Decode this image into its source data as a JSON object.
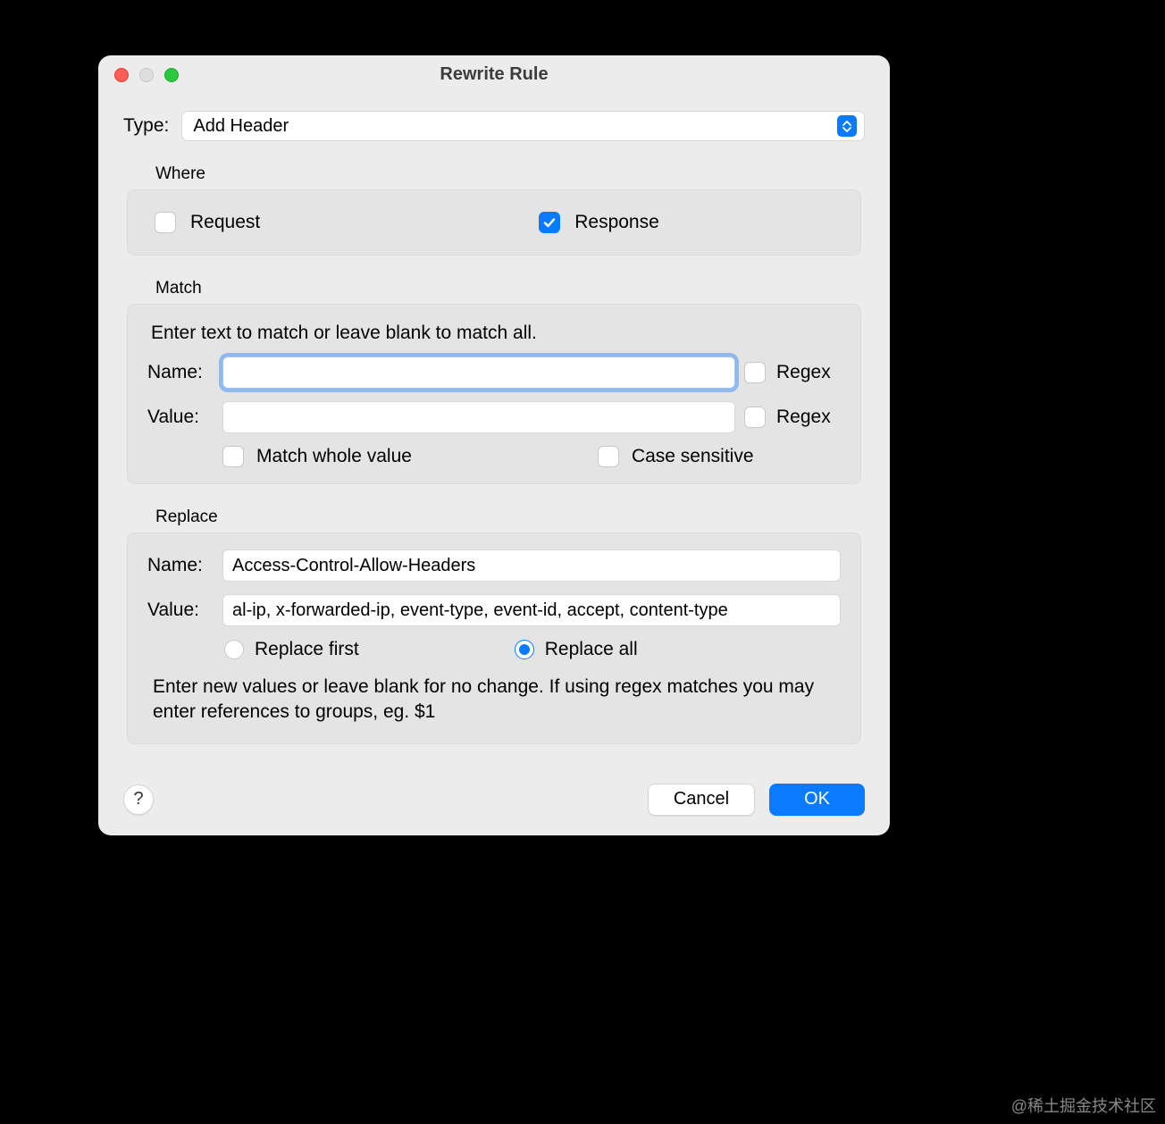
{
  "window": {
    "title": "Rewrite Rule"
  },
  "type": {
    "label": "Type:",
    "value": "Add Header"
  },
  "where": {
    "legend": "Where",
    "request_label": "Request",
    "request_checked": false,
    "response_label": "Response",
    "response_checked": true
  },
  "match": {
    "legend": "Match",
    "help": "Enter text to match or leave blank to match all.",
    "name_label": "Name:",
    "name_value": "",
    "value_label": "Value:",
    "value_value": "",
    "regex_label": "Regex",
    "name_regex_checked": false,
    "value_regex_checked": false,
    "whole_label": "Match whole value",
    "whole_checked": false,
    "case_label": "Case sensitive",
    "case_checked": false
  },
  "replace": {
    "legend": "Replace",
    "name_label": "Name:",
    "name_value": "Access-Control-Allow-Headers",
    "value_label": "Value:",
    "value_value": "al-ip, x-forwarded-ip, event-type, event-id, accept, content-type",
    "first_label": "Replace first",
    "all_label": "Replace all",
    "selected": "all",
    "help": "Enter new values or leave blank for no change. If using regex matches you may enter references to groups, eg. $1"
  },
  "footer": {
    "help": "?",
    "cancel": "Cancel",
    "ok": "OK"
  },
  "watermark": "@稀土掘金技术社区"
}
